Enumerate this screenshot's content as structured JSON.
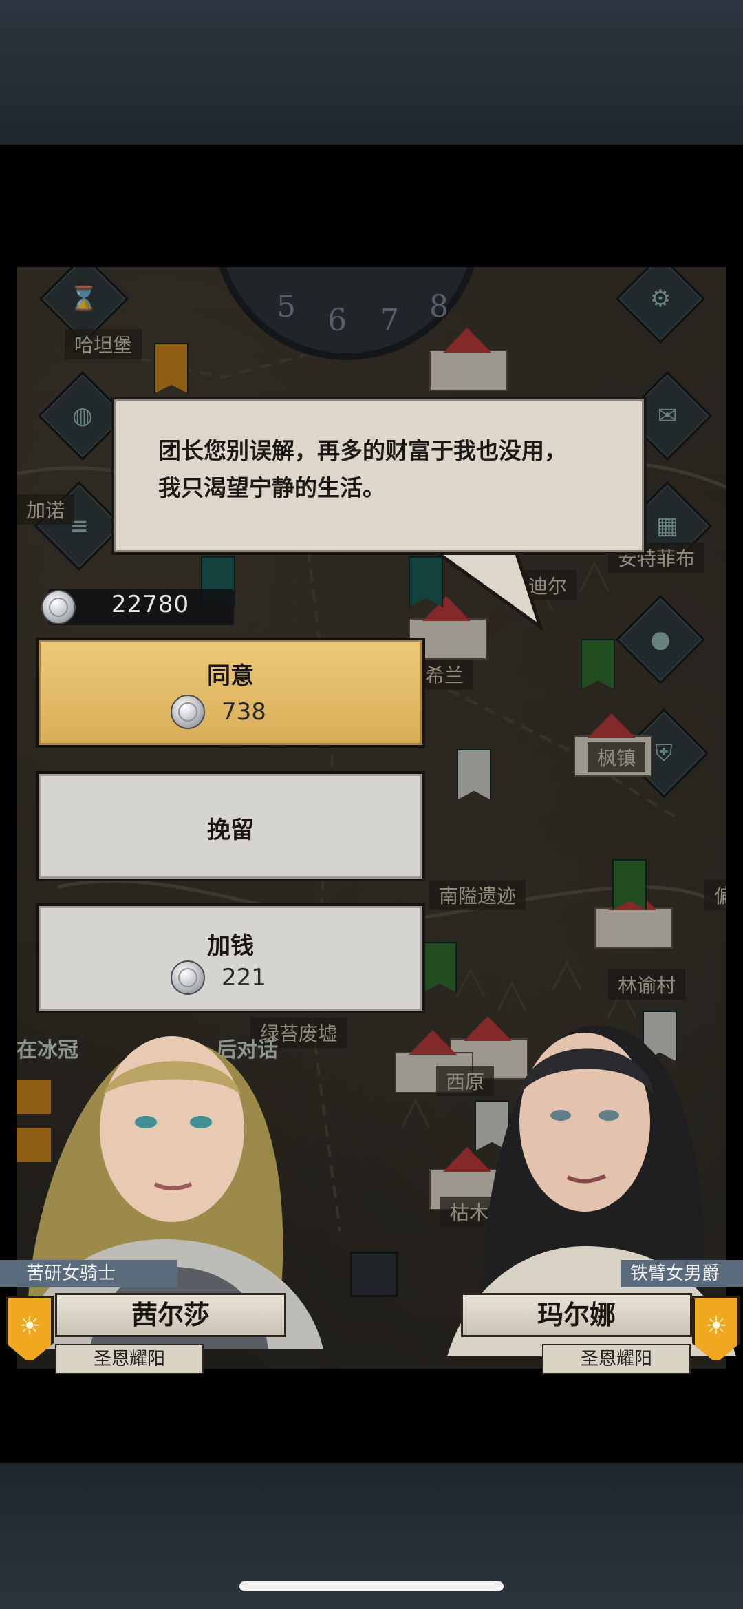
{
  "map": {
    "places": [
      "哈坦堡",
      "加诺",
      "安特菲布",
      "迪尔",
      "希兰",
      "枫镇",
      "南隘遗迹",
      "林谕村",
      "偏",
      "绿苔废墟",
      "西原",
      "枯木堡"
    ],
    "quest_hint": "在冰冠",
    "quest_hint2": "后对话",
    "clock_digits": [
      "5",
      "6",
      "7",
      "8"
    ]
  },
  "dialogue": {
    "line1": "团长您别误解，再多的财富于我也没用，",
    "line2": "我只渴望宁静的生活。"
  },
  "currency": {
    "silver": "22780"
  },
  "choices": [
    {
      "label": "同意",
      "cost": "738"
    },
    {
      "label": "挽留"
    },
    {
      "label": "加钱",
      "cost": "221"
    }
  ],
  "left_character": {
    "title": "苦研女骑士",
    "name": "茜尔莎",
    "faction": "圣恩耀阳"
  },
  "right_character": {
    "title": "铁臂女男爵",
    "name": "玛尔娜",
    "faction": "圣恩耀阳"
  },
  "colors": {
    "gold_choice": "#e3bd6b",
    "gray_choice": "#d6d4d0",
    "accent_emblem": "#f0a820"
  }
}
